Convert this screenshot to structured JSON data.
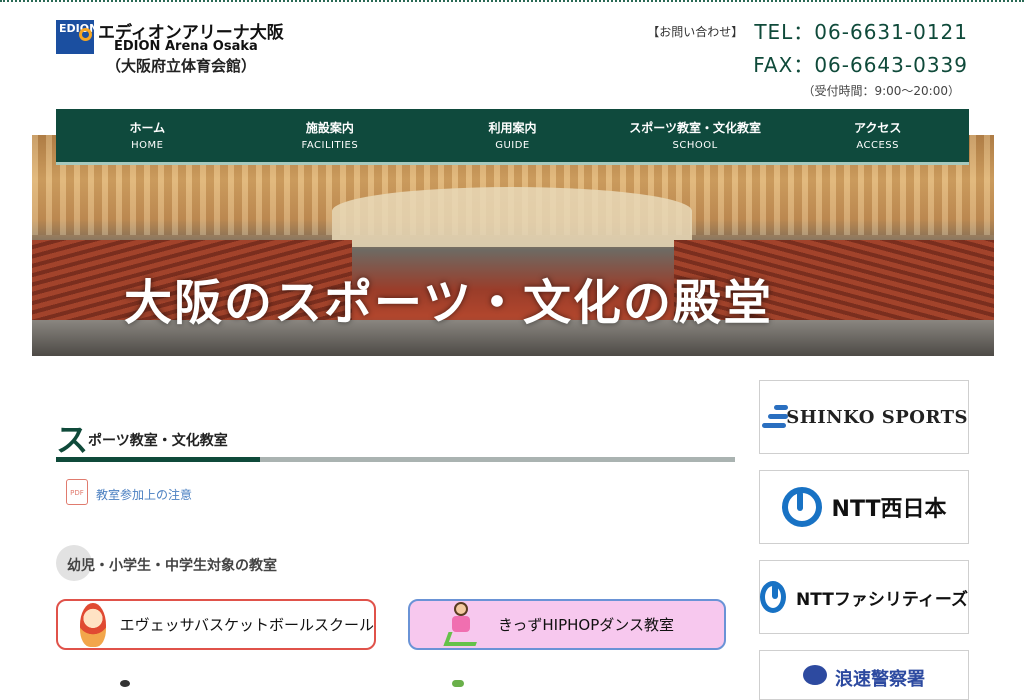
{
  "header": {
    "logo_mark": "EDION",
    "logo_jp": "エディオンアリーナ大阪",
    "logo_en": "EDION Arena Osaka",
    "logo_sub": "（大阪府立体育会館）",
    "contact_label": "【お問い合わせ】",
    "tel": "TEL：06-6631-0121",
    "fax": "FAX：06-6643-0339",
    "hours": "（受付時間：9:00〜20:00）"
  },
  "nav": [
    {
      "jp": "ホーム",
      "en": "HOME"
    },
    {
      "jp": "施設案内",
      "en": "FACILITIES"
    },
    {
      "jp": "利用案内",
      "en": "GUIDE"
    },
    {
      "jp": "スポーツ教室・文化教室",
      "en": "SCHOOL"
    },
    {
      "jp": "アクセス",
      "en": "ACCESS"
    }
  ],
  "hero": {
    "text": "大阪のスポーツ・文化の殿堂"
  },
  "section": {
    "title_first": "ス",
    "title_rest": "ポーツ教室・文化教室",
    "pdf_icon_label": "PDF",
    "pdf_link": "教室参加上の注意",
    "sub_heading": "幼児・小学生・中学生対象の教室",
    "classes": [
      {
        "label": "エヴェッサバスケットボールスクール"
      },
      {
        "label": "きっずHIPHOPダンス教室"
      }
    ]
  },
  "sponsors": {
    "shinko": "SHINKO SPORTS",
    "ntt_west": "NTT西日本",
    "ntt_facilities": "NTTファシリティーズ",
    "police": "浪速警察署"
  },
  "colors": {
    "brand_green": "#0f4a3d",
    "link_blue": "#4a7fc1",
    "btn1_border": "#e0524a",
    "btn2_bg": "#f7c8ee"
  }
}
